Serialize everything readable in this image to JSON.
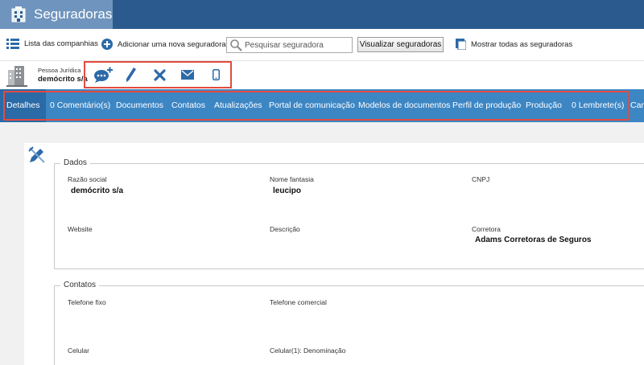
{
  "header": {
    "title": "Seguradoras"
  },
  "toolbar": {
    "list_label": "Lista das companhias",
    "add_label": "Adicionar uma nova seguradora",
    "search_placeholder": "Pesquisar seguradora",
    "view_button": "Visualizar seguradoras",
    "show_all_label": "Mostrar todas as seguradoras"
  },
  "entity": {
    "type": "Pessoa Jurídica",
    "name": "demócrito s/a"
  },
  "actions": [
    "add-comment-icon",
    "edit-icon",
    "delete-icon",
    "email-icon",
    "mobile-icon"
  ],
  "tabs": [
    {
      "label": "Detalhes",
      "active": true
    },
    {
      "label": "0 Comentário(s)"
    },
    {
      "label": "Documentos"
    },
    {
      "label": "Contatos"
    },
    {
      "label": "Atualizações"
    },
    {
      "label": "Portal de comunicação"
    },
    {
      "label": "Modelos de documentos"
    },
    {
      "label": "Perfil de produção"
    },
    {
      "label": "Produção"
    },
    {
      "label": "0 Lembrete(s)"
    },
    {
      "label": "Cana"
    }
  ],
  "dados": {
    "legend": "Dados",
    "razao_social_label": "Razão social",
    "razao_social_value": "demócrito s/a",
    "nome_fantasia_label": "Nome fantasia",
    "nome_fantasia_value": "leucipo",
    "cnpj_label": "CNPJ",
    "website_label": "Website",
    "descricao_label": "Descrição",
    "corretora_label": "Corretora",
    "corretora_value": "Adams Corretoras de Seguros"
  },
  "contatos": {
    "legend": "Contatos",
    "telefone_fixo_label": "Telefone fixo",
    "telefone_comercial_label": "Telefone comercial",
    "celular_label": "Celular",
    "celular1_label": "Celular(1): Denominação"
  },
  "colors": {
    "header": "#2b5b8e",
    "header_tab": "#6f94bd",
    "nav": "#3d86c4",
    "nav_active": "#2a6aa6",
    "highlight": "#e34b3e",
    "icon": "#2c6aa8"
  }
}
